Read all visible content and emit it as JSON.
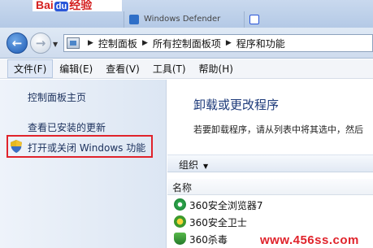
{
  "background_window": {
    "logo_text_left": "Bai",
    "logo_text_du": "du",
    "logo_text_right": "经验",
    "title_fragment": "...",
    "tab1_label": "Windows Defender",
    "tab2_label": "..."
  },
  "address_bar": {
    "crumbs": [
      "控制面板",
      "所有控制面板项",
      "程序和功能"
    ]
  },
  "menu": {
    "items": [
      "文件(F)",
      "编辑(E)",
      "查看(V)",
      "工具(T)",
      "帮助(H)"
    ]
  },
  "left_pane": {
    "home_link": "控制面板主页",
    "updates_link": "查看已安装的更新",
    "features_link": "打开或关闭 Windows 功能"
  },
  "main": {
    "title": "卸载或更改程序",
    "description": "若要卸载程序，请从列表中将其选中，然后",
    "organize_label": "组织",
    "column_name": "名称",
    "programs": [
      {
        "name": "360安全浏览器7",
        "icon": "ie-like-browser-icon"
      },
      {
        "name": "360安全卫士",
        "icon": "guard-icon"
      },
      {
        "name": "360杀毒",
        "icon": "antivirus-shield-icon"
      }
    ]
  },
  "watermark": "www.456ss.com",
  "colors": {
    "highlight": "#e0232b",
    "link": "#1a2f5b",
    "title": "#1d3a7a"
  }
}
